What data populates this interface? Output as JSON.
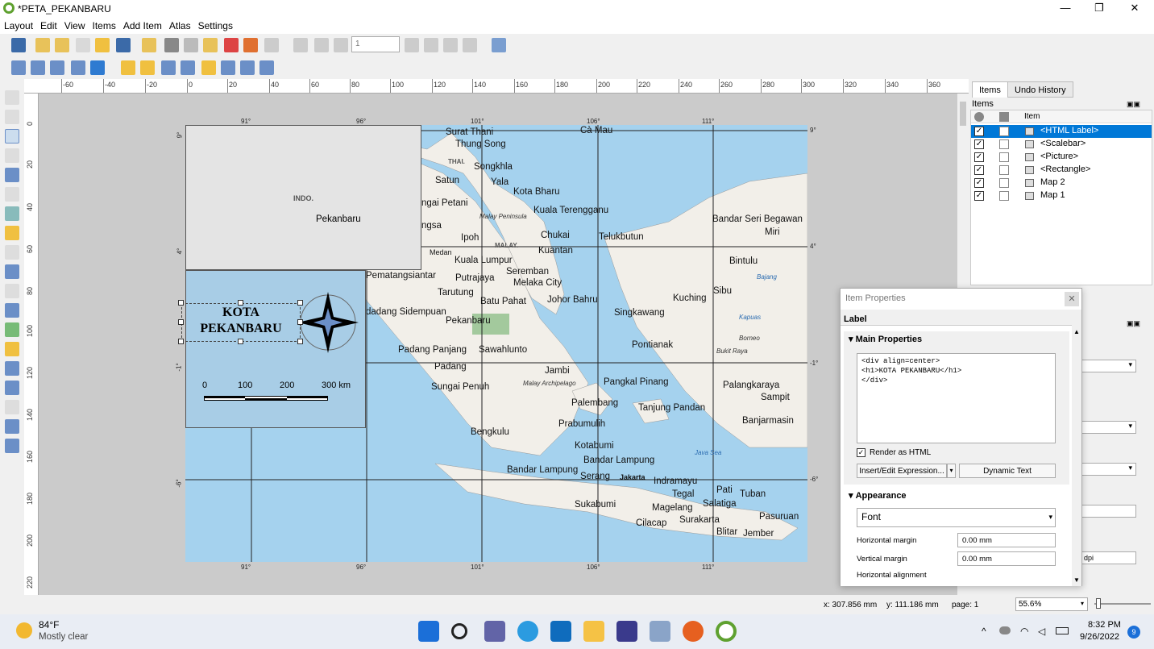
{
  "window": {
    "title": "*PETA_PEKANBARU",
    "minimize": "—",
    "maximize": "❐",
    "close": "✕"
  },
  "menu": [
    "Layout",
    "Edit",
    "View",
    "Items",
    "Add Item",
    "Atlas",
    "Settings"
  ],
  "toolbar": {
    "page_spin_value": "1"
  },
  "ruler_h": [
    "-60",
    "-40",
    "-20",
    "0",
    "20",
    "40",
    "60",
    "80",
    "100",
    "120",
    "140",
    "160",
    "180",
    "200",
    "220",
    "240",
    "260",
    "280",
    "300",
    "320",
    "340",
    "360"
  ],
  "ruler_v": [
    "0",
    "20",
    "40",
    "60",
    "80",
    "100",
    "120",
    "140",
    "160",
    "180",
    "200",
    "220"
  ],
  "map": {
    "coords_top": [
      "91°",
      "96°",
      "101°",
      "106°",
      "111°"
    ],
    "coords_bottom": [
      "91°",
      "96°",
      "101°",
      "106°",
      "111°"
    ],
    "coords_left": [
      "9°",
      "4°",
      "-1°",
      "-6°"
    ],
    "coords_right": [
      "9°",
      "4°",
      "-1°",
      "-6°"
    ],
    "places": [
      "Surat Thani",
      "Thung Song",
      "Songkhla",
      "Yala",
      "Satun",
      "ngai Petani",
      "Kota Bharu",
      "Kuala Terengganu",
      "ngsa",
      "Ipoh",
      "Chukai",
      "Telukbutun",
      "Kuantan",
      "Kuala Lumpur",
      "Medan",
      "Seremban",
      "Putrajaya",
      "Melaka City",
      "Pematangsiantar",
      "Tarutung",
      "Batu Pahat",
      "Johor Bahru",
      "dadang Sidempuan",
      "Pekanbaru",
      "Padang Panjang",
      "Sawahlunto",
      "Padang",
      "Sungai Penuh",
      "Jambi",
      "Palembang",
      "Prabumulih",
      "Bengkulu",
      "Kotabumi",
      "Bandar Lampung",
      "Bandar Lampung",
      "Serang",
      "Jakarta",
      "Sukabumi",
      "Cilacap",
      "Magelang",
      "Surakarta",
      "Tegal",
      "Indramayu",
      "Pati",
      "Salatiga",
      "Blitar",
      "Tuban",
      "Pasuruan",
      "Jember",
      "Pangkal Pinang",
      "Tanjung Pandan",
      "Singkawang",
      "Pontianak",
      "Kuching",
      "Sibu",
      "Bintulu",
      "Miri",
      "Bandar Seri Begawan",
      "Palangkaraya",
      "Sampit",
      "Banjarmasin",
      "Cà Mau"
    ],
    "small": [
      "Malay Peninsula",
      "Malay Archipelago",
      "Borneo",
      "Bukit Raya",
      "Kapuas",
      "Bajang"
    ],
    "countries": [
      "THAI.",
      "MALAY."
    ],
    "sea": [
      "Java Sea"
    ]
  },
  "inset": {
    "country": "INDO.",
    "city": "Pekanbaru"
  },
  "legend": {
    "title_line1": "KOTA",
    "title_line2": "PEKANBARU",
    "scale": [
      "0",
      "100",
      "200",
      "300 km"
    ]
  },
  "dock": {
    "tab_items": "Items",
    "tab_undo": "Undo History",
    "panel_title": "Items",
    "col_item": "Item",
    "items": [
      {
        "name": "<HTML Label>",
        "visible": "✓",
        "selected": true
      },
      {
        "name": "<Scalebar>",
        "visible": "✓",
        "selected": false
      },
      {
        "name": "<Picture>",
        "visible": "✓",
        "selected": false
      },
      {
        "name": "<Rectangle>",
        "visible": "✓",
        "selected": false
      },
      {
        "name": "Map 2",
        "visible": "✓",
        "selected": false
      },
      {
        "name": "Map 1",
        "visible": "✓",
        "selected": false
      }
    ],
    "dpi_value": "dpi"
  },
  "props": {
    "title": "Item Properties",
    "section": "Label",
    "main_properties": "Main Properties",
    "html_text_1": "<div align=center>",
    "html_text_2": "<h1>KOTA PEKANBARU</h1>",
    "html_text_3": "</div>",
    "render_html": "Render as HTML",
    "insert_expr": "Insert/Edit Expression...",
    "dynamic_text": "Dynamic Text",
    "appearance": "Appearance",
    "font": "Font",
    "hmargin_label": "Horizontal margin",
    "hmargin_value": "0.00 mm",
    "vmargin_label": "Vertical margin",
    "vmargin_value": "0.00 mm",
    "halign_label": "Horizontal alignment"
  },
  "status": {
    "x": "x: 307.856 mm",
    "y": "y: 111.186 mm",
    "page": "page: 1",
    "zoom": "55.6%"
  },
  "taskbar": {
    "temp": "84°F",
    "weather": "Mostly clear",
    "time": "8:32 PM",
    "date": "9/26/2022",
    "badge": "9"
  }
}
